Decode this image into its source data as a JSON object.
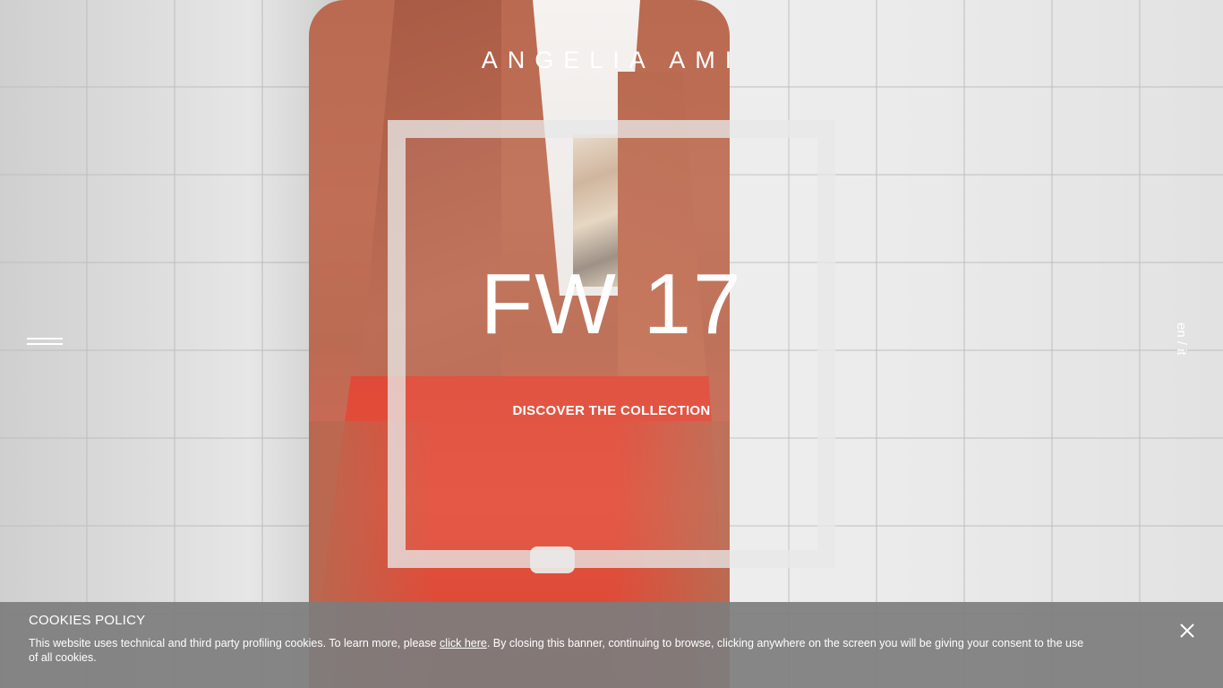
{
  "brand": {
    "name": "ANGELIA AMI"
  },
  "feature": {
    "title": "FW 17",
    "cta_label": "DISCOVER THE COLLECTION"
  },
  "nav": {
    "menu_icon": "hamburger-icon"
  },
  "language": {
    "option_en": "en",
    "separator": "/",
    "option_it": "it"
  },
  "cookies": {
    "title": "COOKIES POLICY",
    "text_before": "This website uses technical and third party profiling cookies. To learn more, please ",
    "link_label": "click here",
    "text_after": ". By closing this banner, continuing to browse, clicking anywhere on the screen you will be giving your consent to the use of all cookies.",
    "close_icon": "close-icon"
  },
  "colors": {
    "banner_bg": "#7d7d7d",
    "text": "#ffffff"
  }
}
